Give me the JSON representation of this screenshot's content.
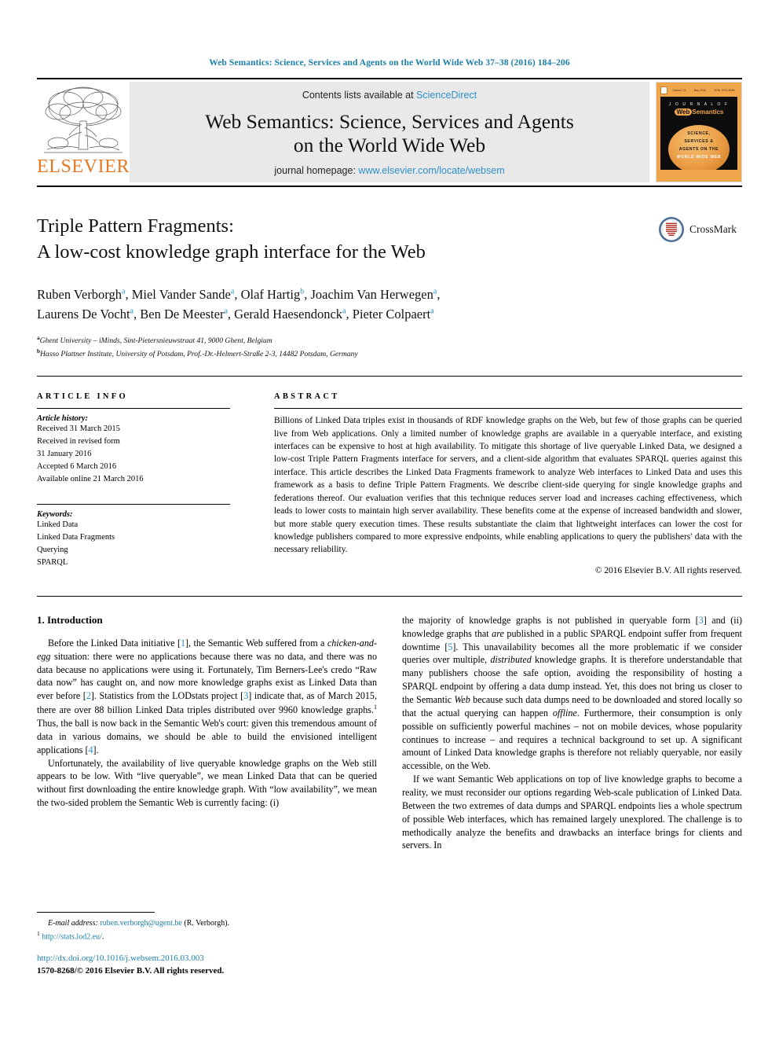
{
  "running_head": "Web Semantics: Science, Services and Agents on the World Wide Web 37–38 (2016) 184–206",
  "masthead": {
    "publisher_logo_label": "ELSEVIER",
    "contents_prefix": "Contents lists available at ",
    "contents_link": "ScienceDirect",
    "journal_title_line1": "Web Semantics: Science, Services and Agents",
    "journal_title_line2": "on the World Wide Web",
    "homepage_prefix": "journal homepage: ",
    "homepage_url": "www.elsevier.com/locate/websem",
    "cover": {
      "top_left": "Volume 1X",
      "top_mid": "May 2016",
      "top_right": "ISSN 1570-8268",
      "journal_of": "J O U R N A L   O F",
      "web": "Web",
      "semantics": "Semantics",
      "line1": "SCIENCE,",
      "line2": "SERVICES &",
      "line3": "AGENTS ON THE",
      "line4": "WORLD WIDE WEB"
    }
  },
  "article": {
    "title_line1": "Triple Pattern Fragments:",
    "title_line2": "A low-cost knowledge graph interface for the Web",
    "crossmark_label": "CrossMark",
    "authors_line1": "Ruben Verborgh ᵃ, Miel Vander Sande ᵃ, Olaf Hartig ᵇ, Joachim Van Herwegen ᵃ,",
    "authors_line2": "Laurens De Vocht ᵃ, Ben De Meester ᵃ, Gerald Haesendonck ᵃ, Pieter Colpaert ᵃ",
    "authors": [
      {
        "name": "Ruben Verborgh",
        "sup": "a"
      },
      {
        "name": "Miel Vander Sande",
        "sup": "a"
      },
      {
        "name": "Olaf Hartig",
        "sup": "b"
      },
      {
        "name": "Joachim Van Herwegen",
        "sup": "a"
      },
      {
        "name": "Laurens De Vocht",
        "sup": "a"
      },
      {
        "name": "Ben De Meester",
        "sup": "a"
      },
      {
        "name": "Gerald Haesendonck",
        "sup": "a"
      },
      {
        "name": "Pieter Colpaert",
        "sup": "a"
      }
    ],
    "affiliations": [
      {
        "marker": "a",
        "text": "Ghent University – iMinds, Sint-Pietersnieuwstraat 41, 9000 Ghent, Belgium"
      },
      {
        "marker": "b",
        "text": "Hasso Plattner Institute, University of Potsdam, Prof.-Dr.-Helmert-Straße 2-3, 14482 Potsdam, Germany"
      }
    ]
  },
  "article_info": {
    "heading": "ARTICLE INFO",
    "history_label": "Article history:",
    "history": [
      "Received 31 March 2015",
      "Received in revised form",
      "31 January 2016",
      "Accepted 6 March 2016",
      "Available online 21 March 2016"
    ],
    "keywords_label": "Keywords:",
    "keywords": [
      "Linked Data",
      "Linked Data Fragments",
      "Querying",
      "SPARQL"
    ]
  },
  "abstract": {
    "heading": "ABSTRACT",
    "text": "Billions of Linked Data triples exist in thousands of RDF knowledge graphs on the Web, but few of those graphs can be queried live from Web applications. Only a limited number of knowledge graphs are available in a queryable interface, and existing interfaces can be expensive to host at high availability. To mitigate this shortage of live queryable Linked Data, we designed a low-cost Triple Pattern Fragments interface for servers, and a client-side algorithm that evaluates SPARQL queries against this interface. This article describes the Linked Data Fragments framework to analyze Web interfaces to Linked Data and uses this framework as a basis to define Triple Pattern Fragments. We describe client-side querying for single knowledge graphs and federations thereof. Our evaluation verifies that this technique reduces server load and increases caching effectiveness, which leads to lower costs to maintain high server availability. These benefits come at the expense of increased bandwidth and slower, but more stable query execution times. These results substantiate the claim that lightweight interfaces can lower the cost for knowledge publishers compared to more expressive endpoints, while enabling applications to query the publishers' data with the necessary reliability.",
    "copyright": "© 2016 Elsevier B.V. All rights reserved."
  },
  "body": {
    "section_heading": "1. Introduction",
    "left_paragraph_1_a": "Before the Linked Data initiative [",
    "left_paragraph_1_ref1": "1",
    "left_paragraph_1_b": "], the Semantic Web suffered from a ",
    "left_paragraph_1_italic1": "chicken-and-egg",
    "left_paragraph_1_c": " situation: there were no applications because there was no data, and there was no data because no applications were using it. Fortunately, Tim Berners-Lee's credo “Raw data now” has caught on, and now more knowledge graphs exist as Linked Data than ever before [",
    "left_paragraph_1_ref2": "2",
    "left_paragraph_1_d": "]. Statistics from the LODstats project [",
    "left_paragraph_1_ref3": "3",
    "left_paragraph_1_e": "] indicate that, as of March 2015, there are over 88 billion Linked Data triples distributed over 9960 knowledge graphs.",
    "left_paragraph_1_fn": "1",
    "left_paragraph_1_f": " Thus, the ball is now back in the Semantic Web's court: given this tremendous amount of data in various domains, we should be able to build the envisioned intelligent applications [",
    "left_paragraph_1_ref4": "4",
    "left_paragraph_1_g": "].",
    "left_paragraph_2": "Unfortunately, the availability of live queryable knowledge graphs on the Web still appears to be low. With “live queryable”, we mean Linked Data that can be queried without first downloading the entire knowledge graph. With “low availability”, we mean the two-sided problem the Semantic Web is currently facing: (i)",
    "right_paragraph_1_a": "the majority of knowledge graphs is not published in queryable form [",
    "right_paragraph_1_ref3": "3",
    "right_paragraph_1_b": "] and (ii) knowledge graphs that ",
    "right_paragraph_1_italic1": "are",
    "right_paragraph_1_c": " published in a public SPARQL endpoint suffer from frequent downtime [",
    "right_paragraph_1_ref5": "5",
    "right_paragraph_1_d": "]. This unavailability becomes all the more problematic if we consider queries over multiple, ",
    "right_paragraph_1_italic2": "distributed",
    "right_paragraph_1_e": " knowledge graphs. It is therefore understandable that many publishers choose the safe option, avoiding the responsibility of hosting a SPARQL endpoint by offering a data dump instead. Yet, this does not bring us closer to the Semantic ",
    "right_paragraph_1_italic3": "Web",
    "right_paragraph_1_f": " because such data dumps need to be downloaded and stored locally so that the actual querying can happen ",
    "right_paragraph_1_italic4": "offline",
    "right_paragraph_1_g": ". Furthermore, their consumption is only possible on sufficiently powerful machines – not on mobile devices, whose popularity continues to increase – and requires a technical background to set up. A significant amount of Linked Data knowledge graphs is therefore not reliably queryable, nor easily accessible, on the Web.",
    "right_paragraph_2": "If we want Semantic Web applications on top of live knowledge graphs to become a reality, we must reconsider our options regarding Web-scale publication of Linked Data. Between the two extremes of data dumps and SPARQL endpoints lies a whole spectrum of possible Web interfaces, which has remained largely unexplored. The challenge is to methodically analyze the benefits and drawbacks an interface brings for clients and servers. In"
  },
  "footnotes": {
    "email_label": "E-mail address:",
    "email_address": "ruben.verborgh@ugent.be",
    "email_suffix": "(R. Verborgh).",
    "fn1_marker": "1",
    "fn1_url": "http://stats.lod2.eu/",
    "fn1_suffix": ".",
    "doi": "http://dx.doi.org/10.1016/j.websem.2016.03.003",
    "issn": "1570-8268/© 2016 Elsevier B.V. All rights reserved."
  },
  "colors": {
    "link": "#2c8fc9",
    "running_head": "#1b7fa8",
    "elsevier_orange": "#e87722",
    "cover_orange": "#f0a64a"
  }
}
